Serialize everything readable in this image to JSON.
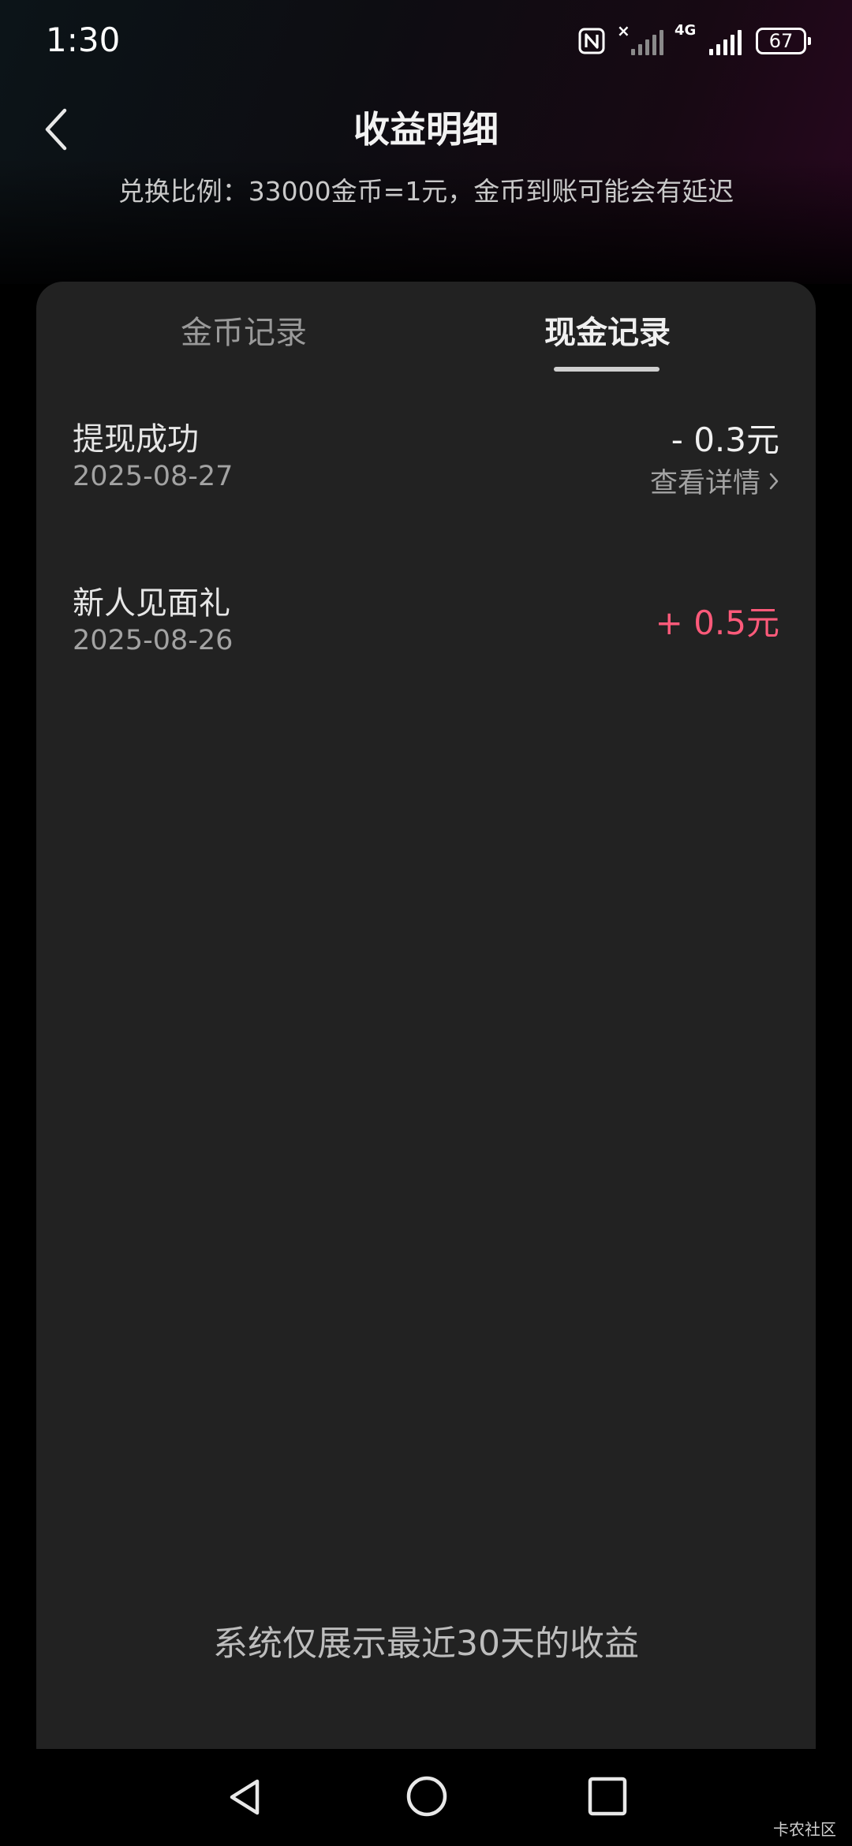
{
  "status_bar": {
    "time": "1:30",
    "network": "4G",
    "battery": "67"
  },
  "header": {
    "title": "收益明细",
    "subtitle": "兑换比例：33000金币=1元，金币到账可能会有延迟"
  },
  "tabs": [
    {
      "label": "金币记录",
      "active": false
    },
    {
      "label": "现金记录",
      "active": true
    }
  ],
  "records": [
    {
      "title": "提现成功",
      "date": "2025-08-27",
      "amount": "- 0.3元",
      "detail_link": "查看详情",
      "amount_color": "#f0f0f0"
    },
    {
      "title": "新人见面礼",
      "date": "2025-08-26",
      "amount": "+ 0.5元",
      "amount_color": "#ff5a7a"
    }
  ],
  "footer_note": "系统仅展示最近30天的收益",
  "watermark": "卡农社区",
  "colors": {
    "positive_amount": "#ff5a7a",
    "card_bg": "#222222"
  }
}
